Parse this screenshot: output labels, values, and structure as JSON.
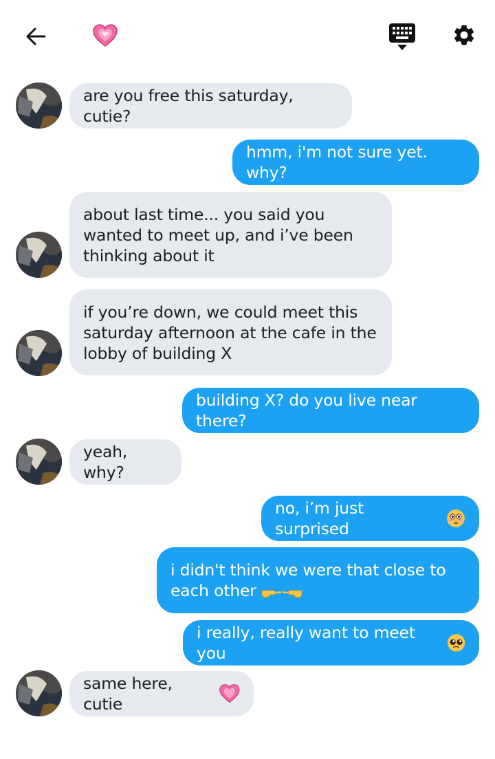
{
  "messages": [
    {
      "dir": "in",
      "text": "are you free this saturday, cutie?",
      "emoji": ""
    },
    {
      "dir": "out",
      "text": "hmm, i'm not sure yet. why?",
      "emoji": ""
    },
    {
      "dir": "in",
      "text": "about last time... you said you\nwanted to meet up, and i’ve been\nthinking about it",
      "emoji": ""
    },
    {
      "dir": "in",
      "text": "if you’re down, we could meet this\nsaturday afternoon at the cafe in the\nlobby of building X",
      "emoji": ""
    },
    {
      "dir": "out",
      "text": "building X? do you live near there?",
      "emoji": ""
    },
    {
      "dir": "in",
      "text": "yeah, why?",
      "emoji": ""
    },
    {
      "dir": "out",
      "text": "no, i’m just surprised",
      "emoji": "flushed-face"
    },
    {
      "dir": "out",
      "text": "i didn't think we were that close to\neach other",
      "emoji": "pointing-fingers"
    },
    {
      "dir": "out",
      "text": "i really, really want to meet you",
      "emoji": "pleading-face"
    },
    {
      "dir": "in",
      "text": "same here, cutie",
      "emoji": "pink-heart"
    }
  ],
  "header": {
    "back_icon": "arrow-left-icon",
    "contact_icon": "growing-heart-icon",
    "keyboard_icon": "keyboard-icon",
    "settings_icon": "gear-icon"
  },
  "colors": {
    "incoming_bubble": "#e6eaef",
    "outgoing_bubble": "#1da1f2",
    "incoming_text": "#1b1e22",
    "outgoing_text": "#ffffff"
  }
}
